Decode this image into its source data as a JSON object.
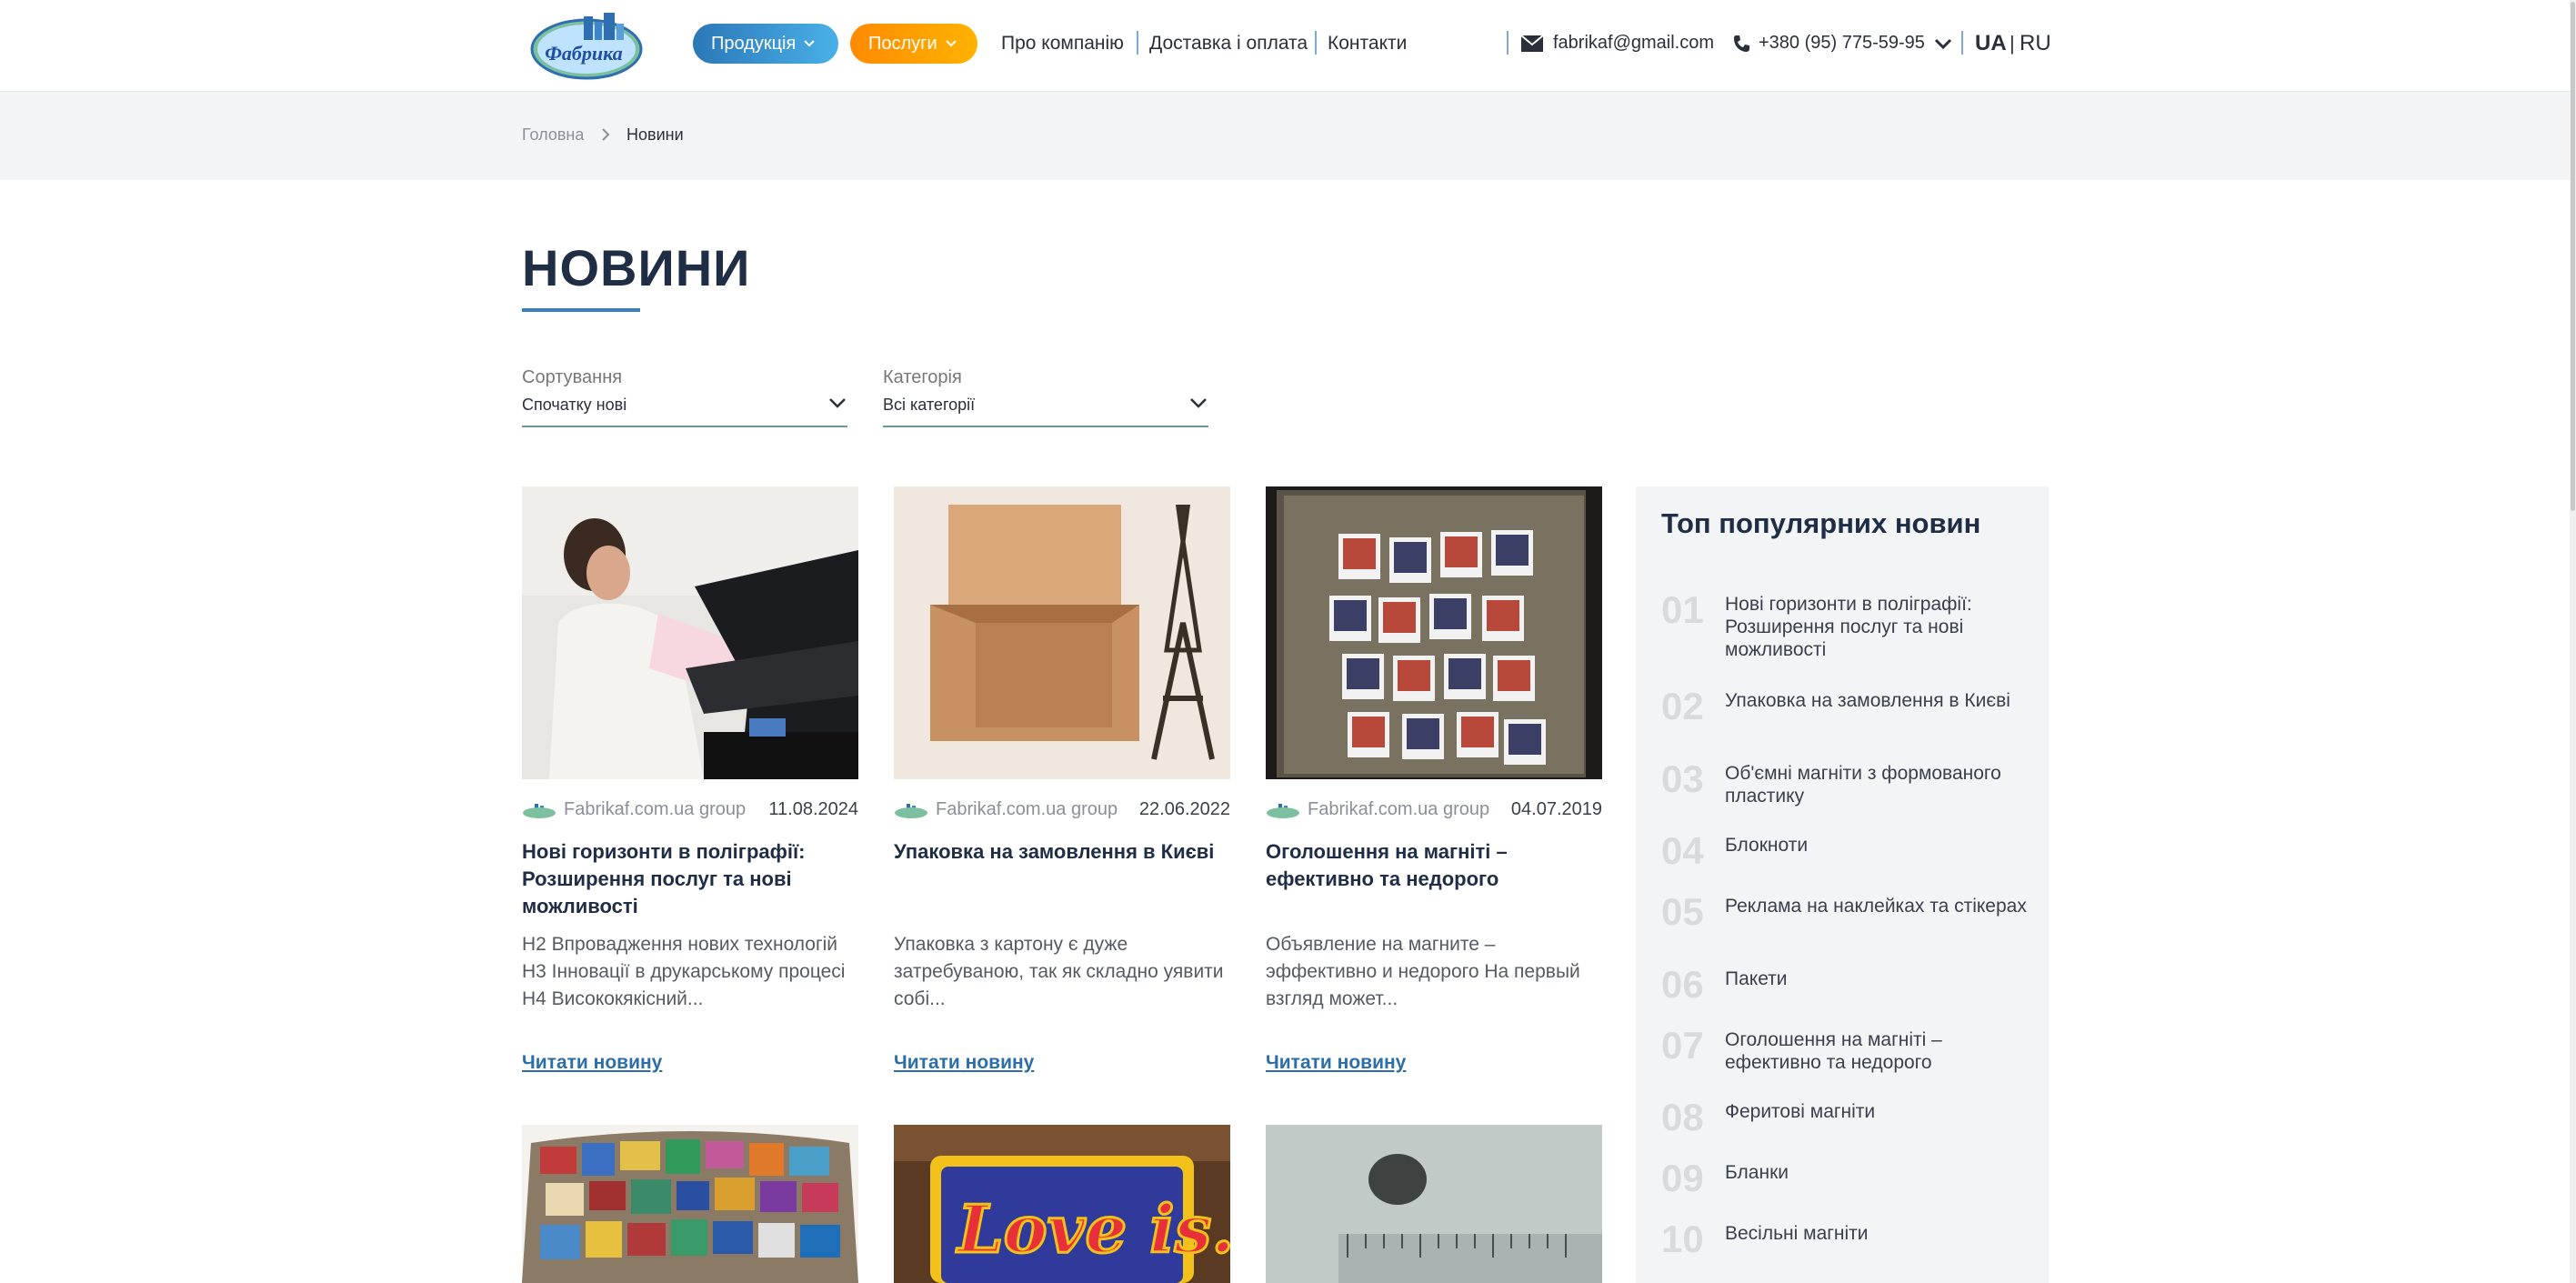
{
  "header": {
    "logo_text": "Фабрика",
    "products_label": "Продукція",
    "services_label": "Послуги",
    "nav": [
      "Про компанію",
      "Доставка і оплата",
      "Контакти"
    ],
    "email": "fabrikaf@gmail.com",
    "phone": "+380 (95) 775-59-95",
    "lang_ua": "UA",
    "lang_sep": "|",
    "lang_ru": "RU"
  },
  "breadcrumb": {
    "home": "Головна",
    "current": "Новини"
  },
  "page": {
    "title": "НОВИНИ"
  },
  "filters": {
    "sort_label": "Сортування",
    "sort_value": "Спочатку нові",
    "category_label": "Категорія",
    "category_value": "Всі категорії"
  },
  "cards": [
    {
      "author": "Fabrikaf.com.ua group",
      "date": "11.08.2024",
      "title": "Нові горизонти в поліграфії: Розширення послуг та нові можливості",
      "excerpt": "H2 Впровадження нових технологій H3 Інновації в друкарському процесі H4 Висококякісний...",
      "link": "Читати новину"
    },
    {
      "author": "Fabrikaf.com.ua group",
      "date": "22.06.2022",
      "title": "Упаковка на замовлення в Києві",
      "excerpt": "Упаковка з картону є дуже затребуваною, так як складно уявити собі...",
      "link": "Читати новину"
    },
    {
      "author": "Fabrikaf.com.ua group",
      "date": "04.07.2019",
      "title": "Оголошення на магніті – ефективно та недорого",
      "excerpt": "Объявление на магните – эффективно и недорого На первый взгляд может...",
      "link": "Читати новину"
    }
  ],
  "second_row_images": [
    "souvenir-magnets-photo",
    "love-is-magnet-photo",
    "small-round-magnet-photo"
  ],
  "sidebar": {
    "title": "Топ популярних новин",
    "items": [
      {
        "num": "01",
        "text": "Нові горизонти в поліграфії: Розширення послуг та нові можливості"
      },
      {
        "num": "02",
        "text": "Упаковка на замовлення в Києві"
      },
      {
        "num": "03",
        "text": "Об'ємні магніти з формованого пластику"
      },
      {
        "num": "04",
        "text": "Блокноти"
      },
      {
        "num": "05",
        "text": "Реклама на наклейках та стікерах"
      },
      {
        "num": "06",
        "text": "Пакети"
      },
      {
        "num": "07",
        "text": "Оголошення на магніті – ефективно та недорого"
      },
      {
        "num": "08",
        "text": "Феритові магніти"
      },
      {
        "num": "09",
        "text": "Бланки"
      },
      {
        "num": "10",
        "text": "Весільні магніти"
      }
    ]
  },
  "colors": {
    "products_button": "#2b77b8",
    "services_button": "#ff8a00",
    "link": "#2c6fa8",
    "title": "#1f2d45"
  }
}
